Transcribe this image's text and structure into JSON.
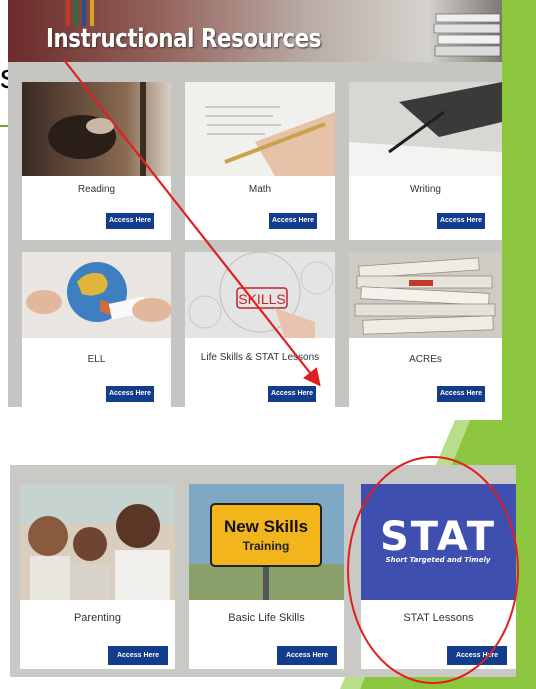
{
  "slide": {
    "partial_heading_char": "s",
    "accent_color": "#8cc63e"
  },
  "resources_page": {
    "title": "Instructional Resources",
    "cards": [
      {
        "label": "Reading",
        "button": "Access Here"
      },
      {
        "label": "Math",
        "button": "Access Here"
      },
      {
        "label": "Writing",
        "button": "Access Here"
      },
      {
        "label": "ELL",
        "button": "Access Here"
      },
      {
        "label": "Life Skills & STAT Lessons",
        "button": "Access Here"
      },
      {
        "label": "ACREs",
        "button": "Access Here"
      }
    ],
    "button_color": "#123c8c"
  },
  "life_skills_page": {
    "cards": [
      {
        "label": "Parenting",
        "button": "Access Here"
      },
      {
        "label": "Basic Life Skills",
        "button": "Access Here",
        "sign_line1": "New Skills",
        "sign_line2": "Training"
      },
      {
        "label": "STAT Lessons",
        "button": "Access Here",
        "logo_text": "STAT",
        "logo_sub": "Short Targeted and Timely"
      }
    ]
  },
  "annotations": {
    "arrow_color": "#e02020",
    "highlight_circle_color": "#e02020"
  }
}
